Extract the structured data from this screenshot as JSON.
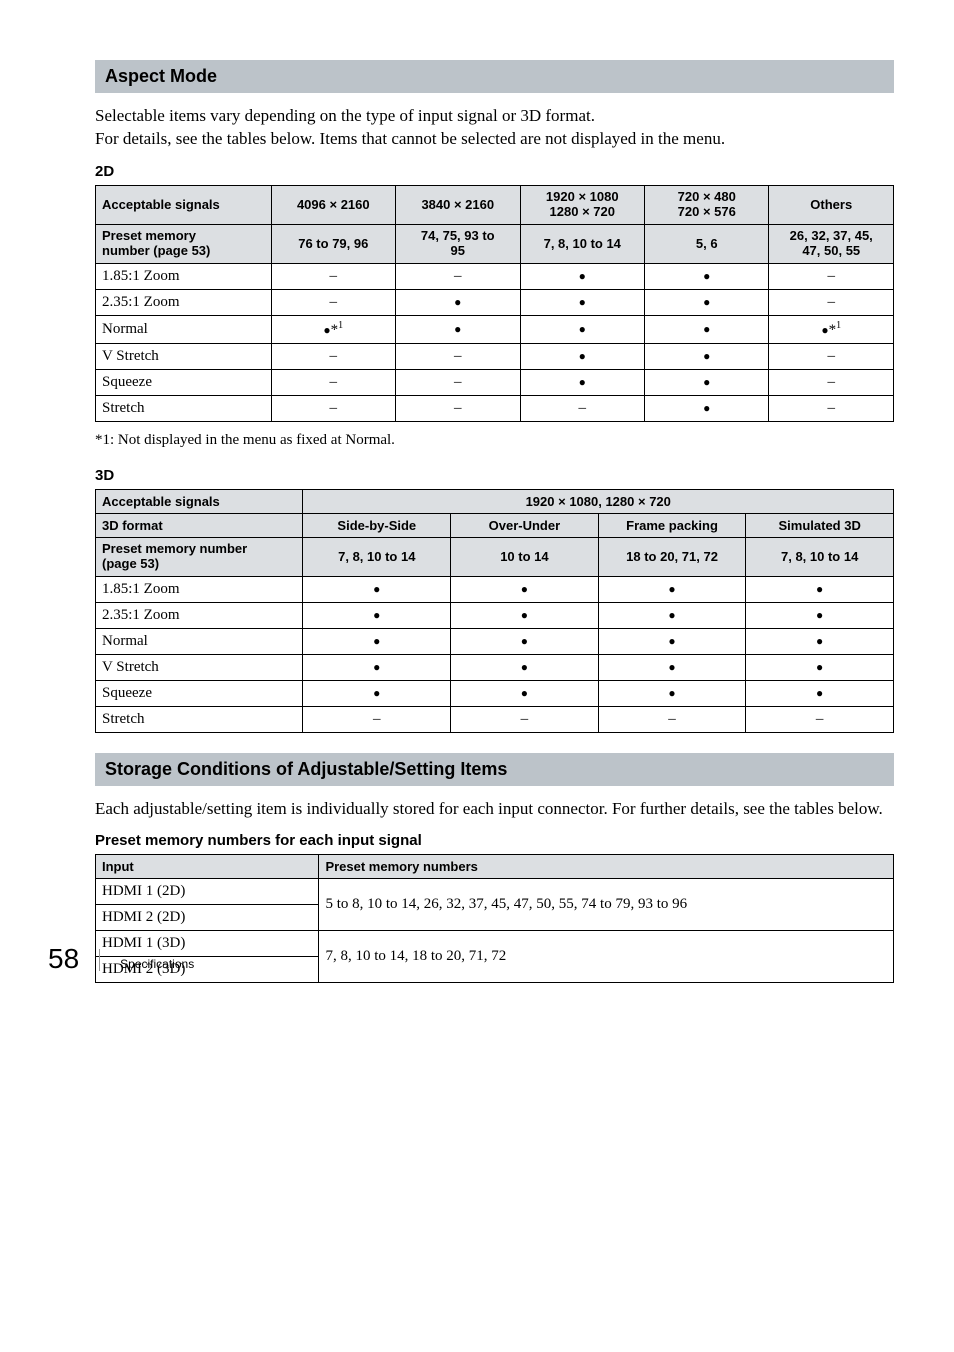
{
  "sectionA": {
    "title": "Aspect Mode",
    "intro_line1": "Selectable items vary depending on the type of input signal or 3D format.",
    "intro_line2": "For details, see the tables below. Items that cannot be selected are not displayed in the menu.",
    "label_2d": "2D",
    "label_3d": "3D",
    "note": "*1: Not displayed in the menu as fixed at Normal."
  },
  "table2d": {
    "headers": {
      "accept": "Acceptable signals",
      "c1": "4096 × 2160",
      "c2": "3840 × 2160",
      "c3_a": "1920 × 1080",
      "c3_b": "1280 × 720",
      "c4_a": "720 × 480",
      "c4_b": "720 × 576",
      "c5": "Others",
      "preset_a": "Preset memory",
      "preset_b": "number (page 53)",
      "p1": "76 to 79, 96",
      "p2_a": "74, 75, 93 to",
      "p2_b": "95",
      "p3": "7, 8, 10 to 14",
      "p4": "5, 6",
      "p5_a": "26, 32, 37, 45,",
      "p5_b": "47, 50, 55"
    },
    "rows": [
      {
        "label": "1.85:1 Zoom",
        "v": [
          "–",
          "–",
          "z",
          "z",
          "–"
        ]
      },
      {
        "label": "2.35:1 Zoom",
        "v": [
          "–",
          "z",
          "z",
          "z",
          "–"
        ]
      },
      {
        "label": "Normal",
        "v": [
          "z*1",
          "z",
          "z",
          "z",
          "z*1"
        ]
      },
      {
        "label": "V Stretch",
        "v": [
          "–",
          "–",
          "z",
          "z",
          "–"
        ]
      },
      {
        "label": "Squeeze",
        "v": [
          "–",
          "–",
          "z",
          "z",
          "–"
        ]
      },
      {
        "label": "Stretch",
        "v": [
          "–",
          "–",
          "–",
          "z",
          "–"
        ]
      }
    ]
  },
  "table3d": {
    "headers": {
      "accept": "Acceptable signals",
      "res": "1920 × 1080, 1280 × 720",
      "fmt": "3D format",
      "f1": "Side-by-Side",
      "f2": "Over-Under",
      "f3": "Frame packing",
      "f4": "Simulated 3D",
      "preset_a": "Preset memory number",
      "preset_b": "(page 53)",
      "p1": "7, 8, 10 to 14",
      "p2": "10 to 14",
      "p3": "18 to 20, 71, 72",
      "p4": "7, 8, 10 to 14"
    },
    "rows": [
      {
        "label": "1.85:1 Zoom",
        "v": [
          "z",
          "z",
          "z",
          "z"
        ]
      },
      {
        "label": "2.35:1 Zoom",
        "v": [
          "z",
          "z",
          "z",
          "z"
        ]
      },
      {
        "label": "Normal",
        "v": [
          "z",
          "z",
          "z",
          "z"
        ]
      },
      {
        "label": "V Stretch",
        "v": [
          "z",
          "z",
          "z",
          "z"
        ]
      },
      {
        "label": "Squeeze",
        "v": [
          "z",
          "z",
          "z",
          "z"
        ]
      },
      {
        "label": "Stretch",
        "v": [
          "–",
          "–",
          "–",
          "–"
        ]
      }
    ]
  },
  "sectionB": {
    "title": "Storage Conditions of Adjustable/Setting Items",
    "intro": "Each adjustable/setting item is individually stored for each input connector. For further details, see the tables below.",
    "subhead": "Preset memory numbers for each input signal",
    "table": {
      "h1": "Input",
      "h2": "Preset memory numbers",
      "rows": [
        {
          "input": "HDMI 1 (2D)",
          "val": "5 to 8, 10 to 14, 26, 32, 37, 45, 47, 50, 55, 74 to 79, 93 to 96"
        },
        {
          "input": "HDMI 2 (2D)",
          "val": null
        },
        {
          "input": "HDMI 1 (3D)",
          "val": "7, 8, 10 to 14, 18 to 20, 71, 72"
        },
        {
          "input": "HDMI 2 (3D)",
          "val": null
        }
      ]
    }
  },
  "footer": {
    "page": "58",
    "label": "Specifications"
  }
}
